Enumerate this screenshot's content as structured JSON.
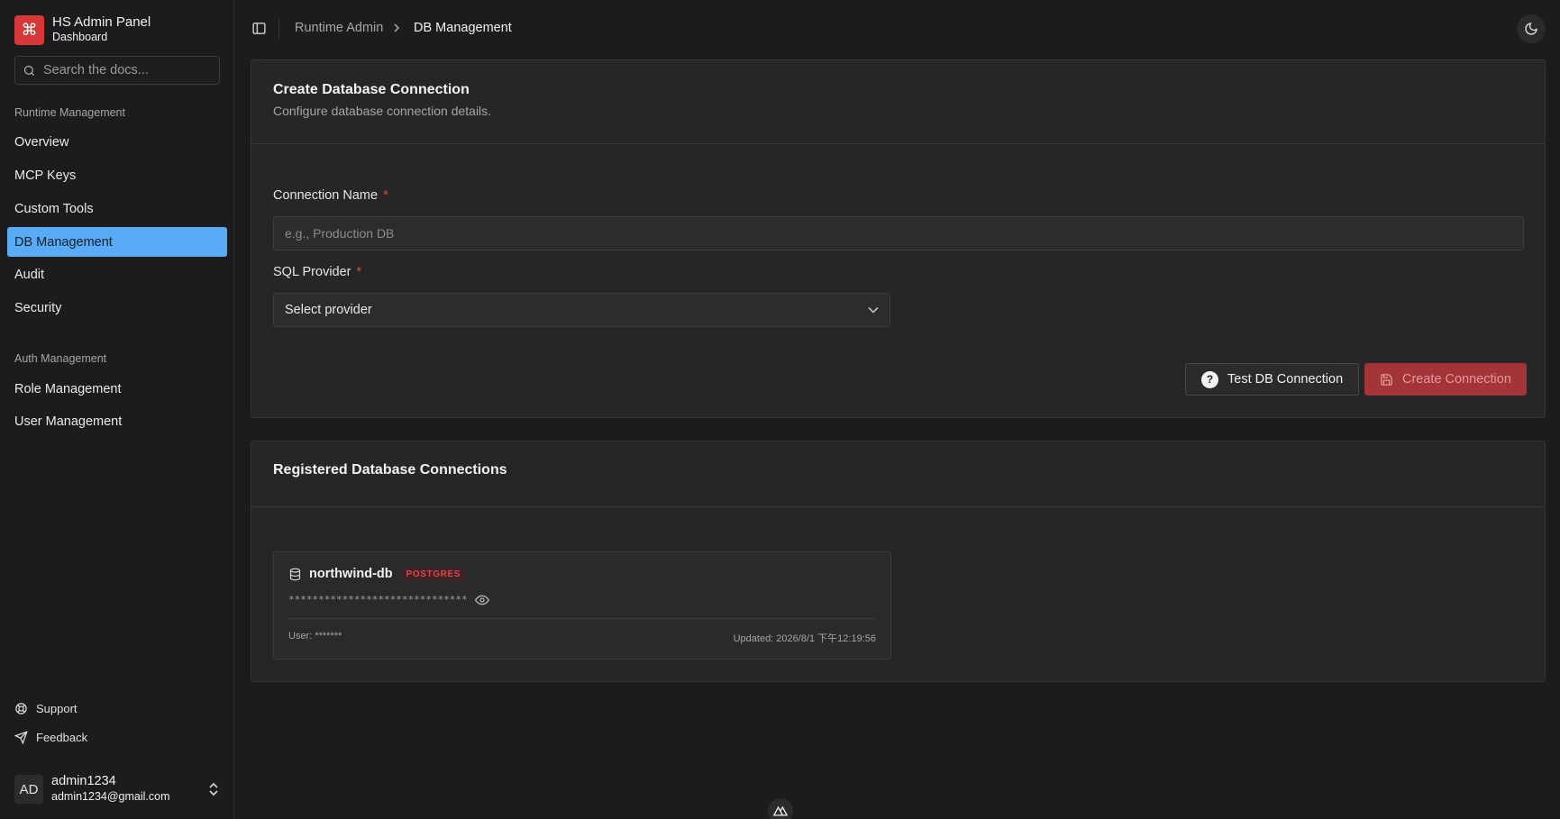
{
  "brand": {
    "title": "HS Admin Panel",
    "subtitle": "Dashboard",
    "logo_icon": "command-icon",
    "logo_color": "#d9383a"
  },
  "search": {
    "placeholder": "Search the docs..."
  },
  "sidebar": {
    "groups": [
      {
        "label": "Runtime Management",
        "items": [
          "Overview",
          "MCP Keys",
          "Custom Tools",
          "DB Management",
          "Audit",
          "Security"
        ]
      },
      {
        "label": "Auth Management",
        "items": [
          "Role Management",
          "User Management"
        ]
      }
    ],
    "active_item": "DB Management",
    "active_color": "#5aabf5",
    "footer": [
      {
        "label": "Support",
        "icon": "lifebuoy-icon"
      },
      {
        "label": "Feedback",
        "icon": "send-icon"
      }
    ]
  },
  "user": {
    "initials": "AD",
    "name": "admin1234",
    "email": "admin1234@gmail.com"
  },
  "breadcrumb": {
    "parent": "Runtime Admin",
    "current": "DB Management"
  },
  "create_card": {
    "title": "Create Database Connection",
    "description": "Configure database connection details.",
    "name_label": "Connection Name",
    "name_placeholder": "e.g., Production DB",
    "provider_label": "SQL Provider",
    "provider_value": "Select provider",
    "required_mark": "*",
    "test_button": "Test DB Connection",
    "create_button": "Create Connection"
  },
  "registered_card": {
    "title": "Registered Database Connections",
    "connections": [
      {
        "name": "northwind-db",
        "provider": "POSTGRES",
        "masked_connection_string": "******************************",
        "user": "User: *******",
        "updated": "Updated: 2026/8/1 下午12:19:56"
      }
    ]
  }
}
